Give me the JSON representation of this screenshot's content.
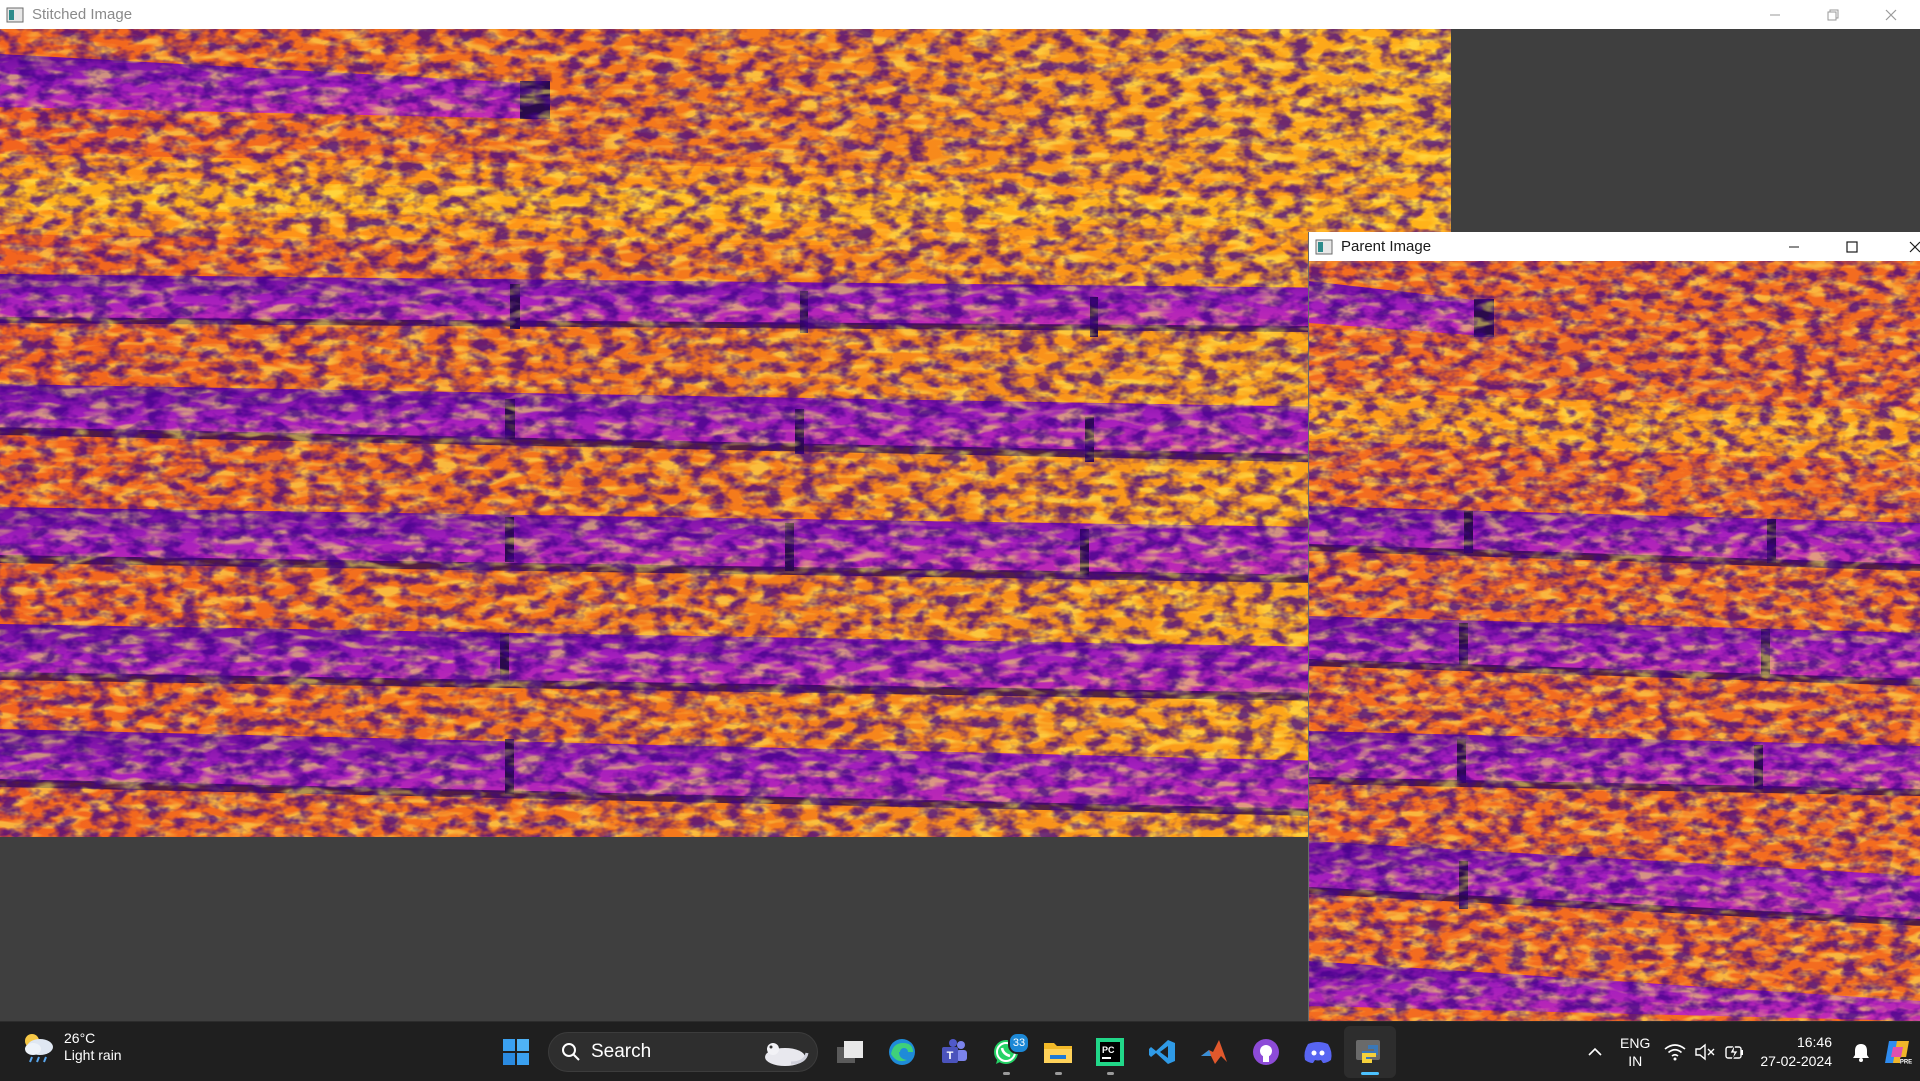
{
  "windows": {
    "stitched": {
      "title": "Stitched Image",
      "focused": false
    },
    "parent": {
      "title": "Parent Image",
      "focused": true
    }
  },
  "controls": {
    "minimize": "minimize-icon",
    "maximize": "maximize-icon",
    "restore": "restore-icon",
    "close": "close-icon"
  },
  "thermal_palette": [
    "#2a0a4a",
    "#7a10a0",
    "#c018b0",
    "#e8307a",
    "#f86a2a",
    "#ffa41a",
    "#ffe31a"
  ],
  "taskbar": {
    "weather": {
      "temperature": "26°C",
      "condition": "Light rain",
      "icon": "cloud-rain-sun-icon"
    },
    "search": {
      "label": "Search"
    },
    "apps": [
      {
        "name": "start",
        "icon": "windows-logo-icon"
      },
      {
        "name": "task-view",
        "icon": "task-view-icon"
      },
      {
        "name": "edge",
        "icon": "edge-icon"
      },
      {
        "name": "teams",
        "icon": "teams-icon"
      },
      {
        "name": "whatsapp",
        "icon": "whatsapp-icon",
        "badge": "33"
      },
      {
        "name": "file-explorer",
        "icon": "folder-icon"
      },
      {
        "name": "pycharm",
        "icon": "pycharm-icon"
      },
      {
        "name": "vscode",
        "icon": "vscode-icon"
      },
      {
        "name": "matlab",
        "icon": "matlab-icon"
      },
      {
        "name": "github",
        "icon": "github-icon"
      },
      {
        "name": "discord",
        "icon": "discord-icon"
      },
      {
        "name": "python",
        "icon": "python-icon"
      }
    ],
    "language": {
      "line1": "ENG",
      "line2": "IN"
    },
    "clock": {
      "time": "16:46",
      "date": "27-02-2024"
    }
  }
}
